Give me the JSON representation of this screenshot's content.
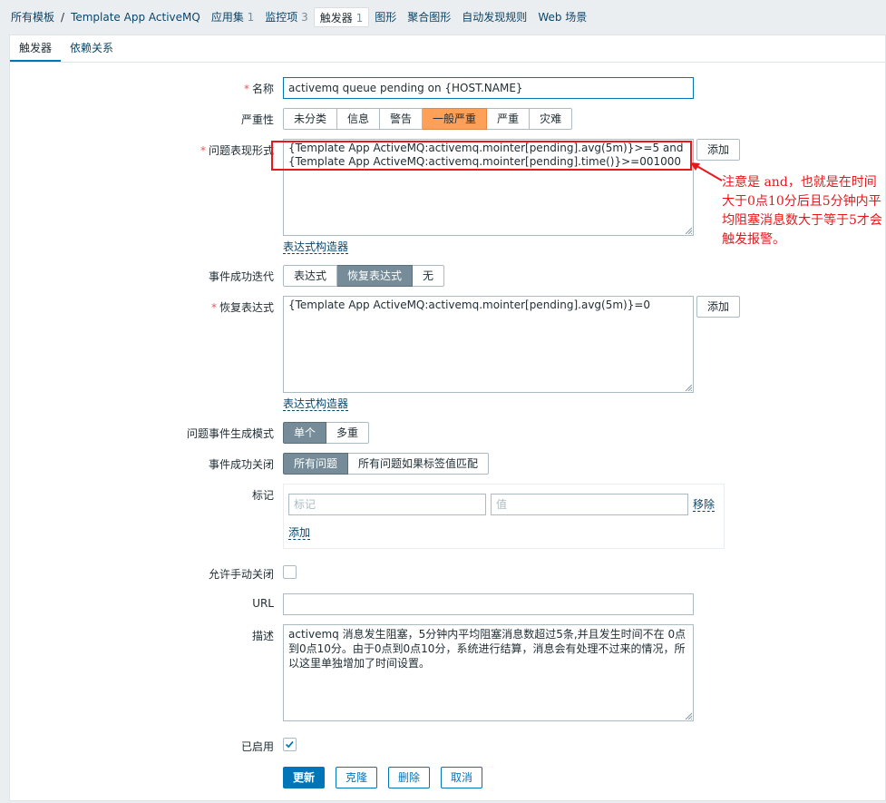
{
  "breadcrumb": {
    "all_templates": "所有模板",
    "template_name": "Template App ActiveMQ",
    "apps": {
      "label": "应用集",
      "count": "1"
    },
    "items": {
      "label": "监控项",
      "count": "3"
    },
    "triggers": {
      "label": "触发器",
      "count": "1"
    },
    "graphs": "图形",
    "screens": "聚合图形",
    "discovery": "自动发现规则",
    "web": "Web 场景"
  },
  "tabs": {
    "trigger": "触发器",
    "dependencies": "依赖关系"
  },
  "form": {
    "name": {
      "label": "名称",
      "value": "activemq queue  pending on {HOST.NAME}"
    },
    "severity": {
      "label": "严重性",
      "options": [
        "未分类",
        "信息",
        "警告",
        "一般严重",
        "严重",
        "灾难"
      ],
      "selected": "一般严重"
    },
    "expression": {
      "label": "问题表现形式",
      "value": "{Template App ActiveMQ:activemq.mointer[pending].avg(5m)}>=5 and {Template App ActiveMQ:activemq.mointer[pending].time()}>=001000",
      "add": "添加",
      "builder": "表达式构造器"
    },
    "ok_event": {
      "label": "事件成功迭代",
      "options": [
        "表达式",
        "恢复表达式",
        "无"
      ],
      "selected": "恢复表达式"
    },
    "recovery": {
      "label": "恢复表达式",
      "value": "{Template App ActiveMQ:activemq.mointer[pending].avg(5m)}=0",
      "add": "添加",
      "builder": "表达式构造器"
    },
    "mode": {
      "label": "问题事件生成模式",
      "options": [
        "单个",
        "多重"
      ],
      "selected": "单个"
    },
    "ok_close": {
      "label": "事件成功关闭",
      "options": [
        "所有问题",
        "所有问题如果标签值匹配"
      ],
      "selected": "所有问题"
    },
    "tags": {
      "label": "标记",
      "tag_placeholder": "标记",
      "value_placeholder": "值",
      "remove": "移除",
      "add": "添加"
    },
    "manual_close": {
      "label": "允许手动关闭"
    },
    "url": {
      "label": "URL",
      "value": ""
    },
    "description": {
      "label": "描述",
      "value": "activemq 消息发生阻塞，5分钟内平均阻塞消息数超过5条,并且发生时间不在 0点到0点10分。由于0点到0点10分，系统进行结算，消息会有处理不过来的情况，所以这里单独增加了时间设置。"
    },
    "enabled": {
      "label": "已启用"
    }
  },
  "buttons": {
    "update": "更新",
    "clone": "克隆",
    "delete": "删除",
    "cancel": "取消"
  },
  "annotation": {
    "text": "注意是 and，也就是在时间大于0点10分后且5分钟内平均阻塞消息数大于等于5才会触发报警。"
  },
  "colors": {
    "accent": "#0275b8",
    "severity_average": "#ffa059",
    "annotation": "#e8171c"
  }
}
